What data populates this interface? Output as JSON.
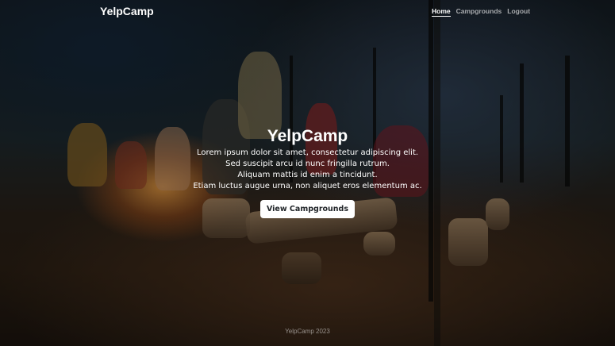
{
  "navbar": {
    "brand": "YelpCamp",
    "links": [
      {
        "label": "Home",
        "active": true
      },
      {
        "label": "Campgrounds",
        "active": false
      },
      {
        "label": "Logout",
        "active": false
      }
    ]
  },
  "hero": {
    "title": "YelpCamp",
    "lines": [
      "Lorem ipsum dolor sit amet, consectetur adipiscing elit.",
      "Sed suscipit arcu id nunc fringilla rutrum.",
      "Aliquam mattis id enim a tincidunt.",
      "Etiam luctus augue urna, non aliquet eros elementum ac."
    ],
    "button_label": "View Campgrounds"
  },
  "footer": {
    "text": "YelpCamp 2023"
  },
  "colors": {
    "button_bg": "#ffffff",
    "button_text": "#212529",
    "nav_inactive": "rgba(255,255,255,0.62)"
  }
}
